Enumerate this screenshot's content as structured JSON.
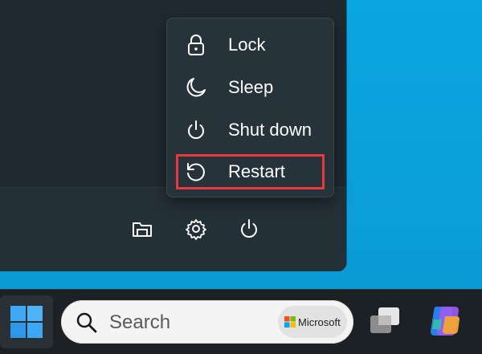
{
  "power_menu": {
    "items": [
      {
        "label": "Lock",
        "icon": "lock-icon"
      },
      {
        "label": "Sleep",
        "icon": "moon-icon"
      },
      {
        "label": "Shut down",
        "icon": "power-icon"
      },
      {
        "label": "Restart",
        "icon": "restart-icon"
      }
    ],
    "highlighted_item": "Restart"
  },
  "start_footer": {
    "icons": [
      "file-explorer-icon",
      "settings-icon",
      "power-icon"
    ]
  },
  "taskbar": {
    "search_placeholder": "Search",
    "search_brand": "Microsoft",
    "icons": [
      "windows-start-icon",
      "search-icon",
      "task-view-icon",
      "copilot-icon"
    ]
  },
  "colors": {
    "desktop": "#0aa6e2",
    "menu_bg": "#26333a",
    "highlight": "#e8383d",
    "taskbar": "#1c2125"
  }
}
